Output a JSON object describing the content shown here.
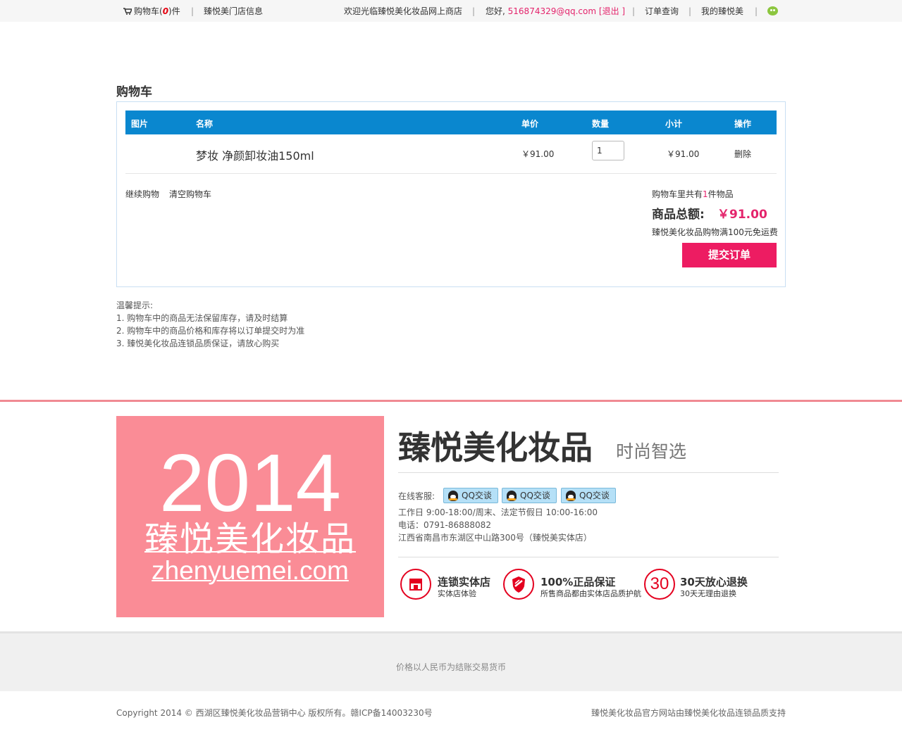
{
  "topbar": {
    "cart_prefix": "购物车(",
    "cart_count": "0",
    "cart_suffix": ")件",
    "store_info": "臻悦美门店信息",
    "welcome": "欢迎光临臻悦美化妆品网上商店",
    "greeting": "您好,",
    "user_email": "516874329@qq.com",
    "logout_open": "[",
    "logout": "退出",
    "logout_close": "]",
    "order_query": "订单查询",
    "my_account": "我的臻悦美",
    "separator": "|",
    "icons": {
      "cart": "cart-icon",
      "wechat": "wechat-icon"
    }
  },
  "cart": {
    "title": "购物车",
    "columns": [
      "图片",
      "名称",
      "单价",
      "数量",
      "小计",
      "操作"
    ],
    "items": [
      {
        "name": "梦妆 净颜卸妆油150ml",
        "price": "￥91.00",
        "quantity": "1",
        "subtotal": "￥91.00",
        "action": "删除"
      }
    ],
    "continue_shopping": "继续购物",
    "clear_cart": "清空购物车",
    "count_prefix": "购物车里共有",
    "count": "1",
    "count_suffix": "件物品",
    "total_label": "商品总额:",
    "total_amount": "￥91.00",
    "shipping_note": "臻悦美化妆品购物满100元免运费",
    "submit_label": "提交订单"
  },
  "tips": {
    "title": "温馨提示:",
    "lines": [
      "1. 购物车中的商品无法保留库存，请及时结算",
      "2. 购物车中的商品价格和库存将以订单提交时为准",
      "3. 臻悦美化妆品连锁品质保证，请放心购买"
    ]
  },
  "footer": {
    "logo_year": "2014",
    "logo_cn": "臻悦美化妆品",
    "logo_en": "zhenyuemei.com",
    "brand_title": "臻悦美化妆品",
    "brand_sub": "时尚智选",
    "contact_label": "在线客服:",
    "qq_buttons": [
      "QQ交谈",
      "QQ交谈",
      "QQ交谈"
    ],
    "hours": "工作日 9:00-18:00/周末、法定节假日 10:00-16:00",
    "phone": "电话：0791-86888082",
    "address": "江西省南昌市东湖区中山路300号（臻悦美实体店）",
    "badges": [
      {
        "icon": "store-icon",
        "title": "连锁实体店",
        "sub": "实体店体验"
      },
      {
        "icon": "shield-icon",
        "title": "100%正品保证",
        "sub": "所售商品都由实体店品质护航"
      },
      {
        "icon": "thirty-days-icon",
        "icon_text": "30",
        "title": "30天放心退换",
        "sub": "30天无理由退换"
      }
    ],
    "currency_note": "价格以人民币为结账交易货币",
    "copyright": "Copyright 2014 © 西湖区臻悦美化妆品营销中心 版权所有。赣ICP备14003230号",
    "support": "臻悦美化妆品官方网站由臻悦美化妆品连锁品质支持"
  },
  "colors": {
    "accent_blue": "#0a87cf",
    "accent_pink": "#e4246c",
    "submit_pink": "#ed1c62",
    "logo_pink": "#fa8c96",
    "badge_red": "#e4001f"
  }
}
